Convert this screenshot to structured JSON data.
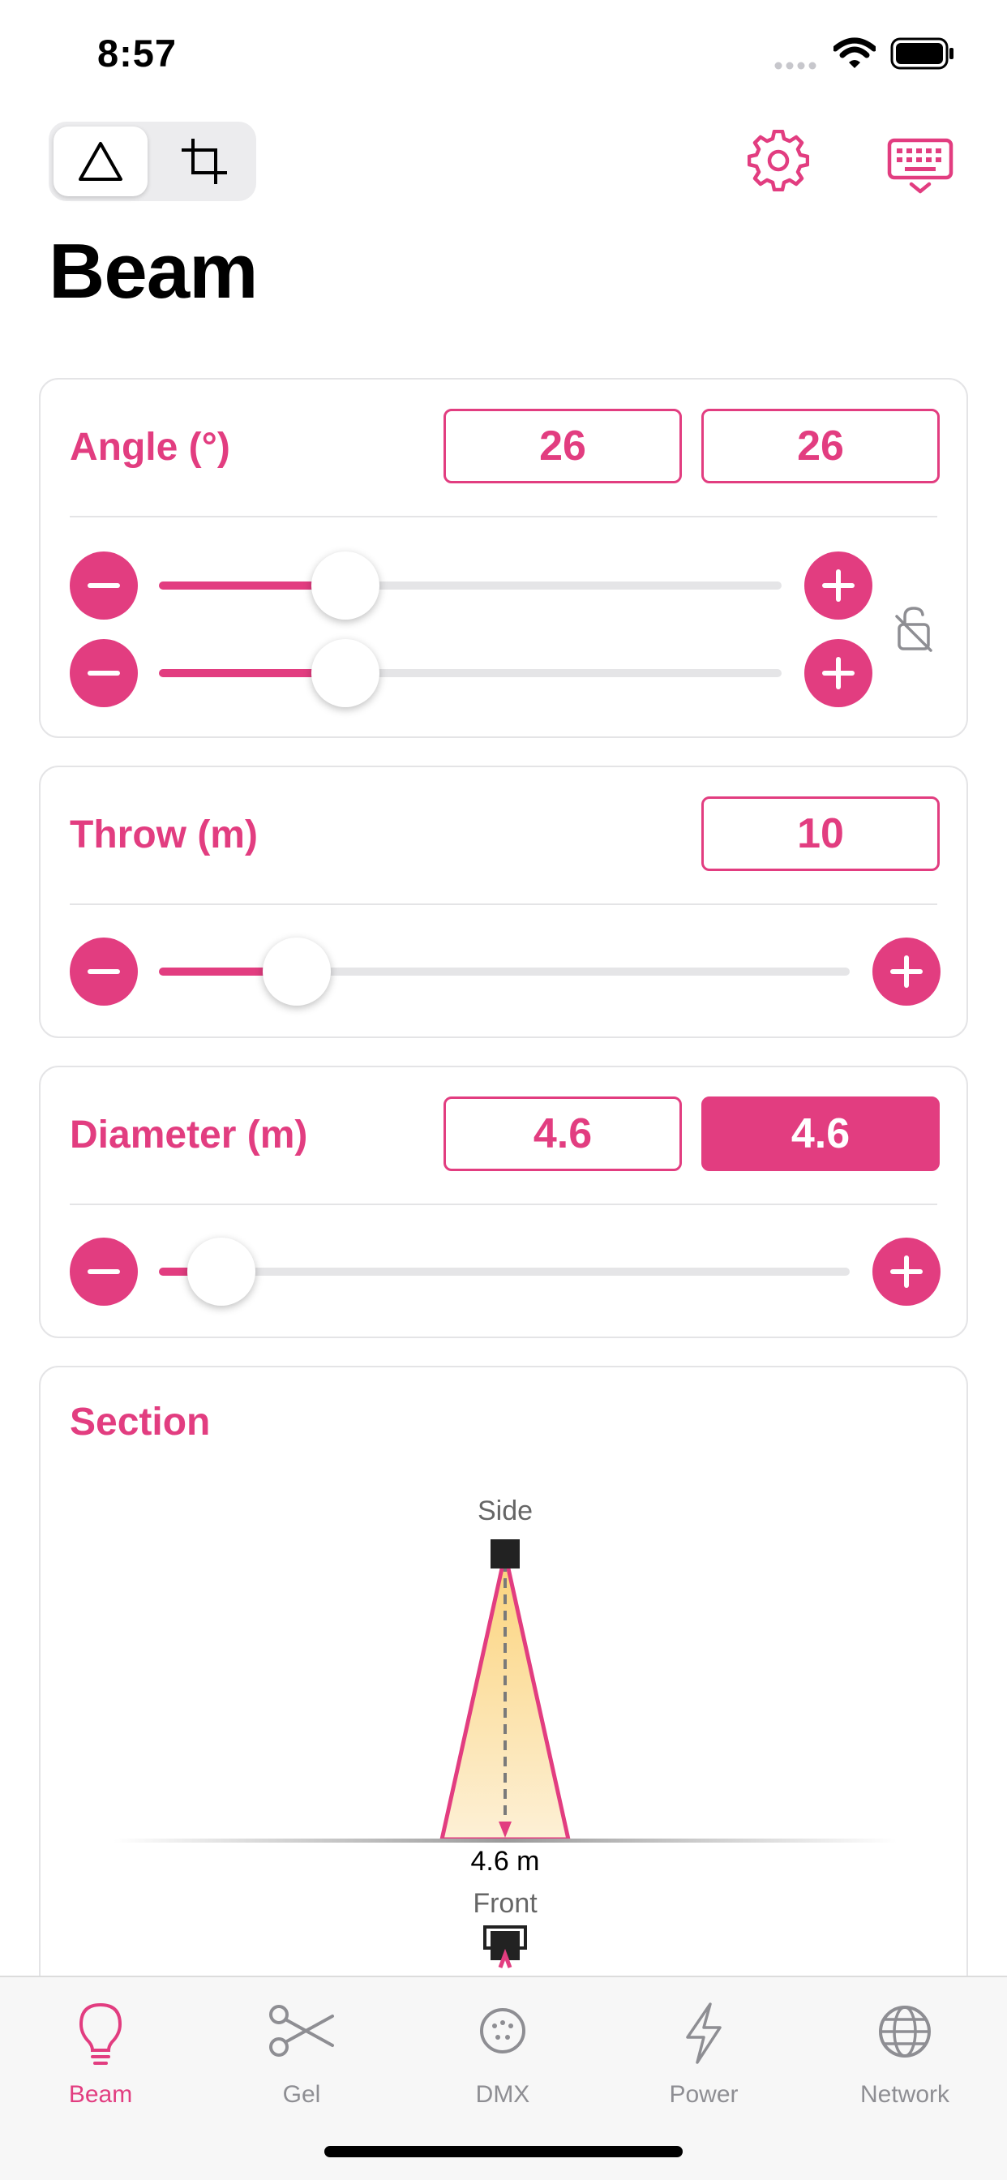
{
  "status_bar": {
    "time": "8:57"
  },
  "header": {
    "title": "Beam"
  },
  "angle": {
    "label": "Angle (°)",
    "value_1": "26",
    "value_2": "26",
    "slider_1": 0.3,
    "slider_2": 0.3
  },
  "throw": {
    "label": "Throw (m)",
    "value": "10",
    "slider": 0.2
  },
  "diameter": {
    "label": "Diameter (m)",
    "value_1": "4.6",
    "value_2": "4.6",
    "slider": 0.09
  },
  "section": {
    "label": "Section",
    "side_label": "Side",
    "diameter_label": "4.6 m",
    "front_label": "Front"
  },
  "tabs": [
    {
      "label": "Beam",
      "icon": "lightbulb-icon",
      "active": true
    },
    {
      "label": "Gel",
      "icon": "scissors-icon",
      "active": false
    },
    {
      "label": "DMX",
      "icon": "dmx-connector-icon",
      "active": false
    },
    {
      "label": "Power",
      "icon": "bolt-icon",
      "active": false
    },
    {
      "label": "Network",
      "icon": "globe-icon",
      "active": false
    }
  ],
  "colors": {
    "accent": "#e23d80",
    "beam_fill": "#fde2a6"
  }
}
